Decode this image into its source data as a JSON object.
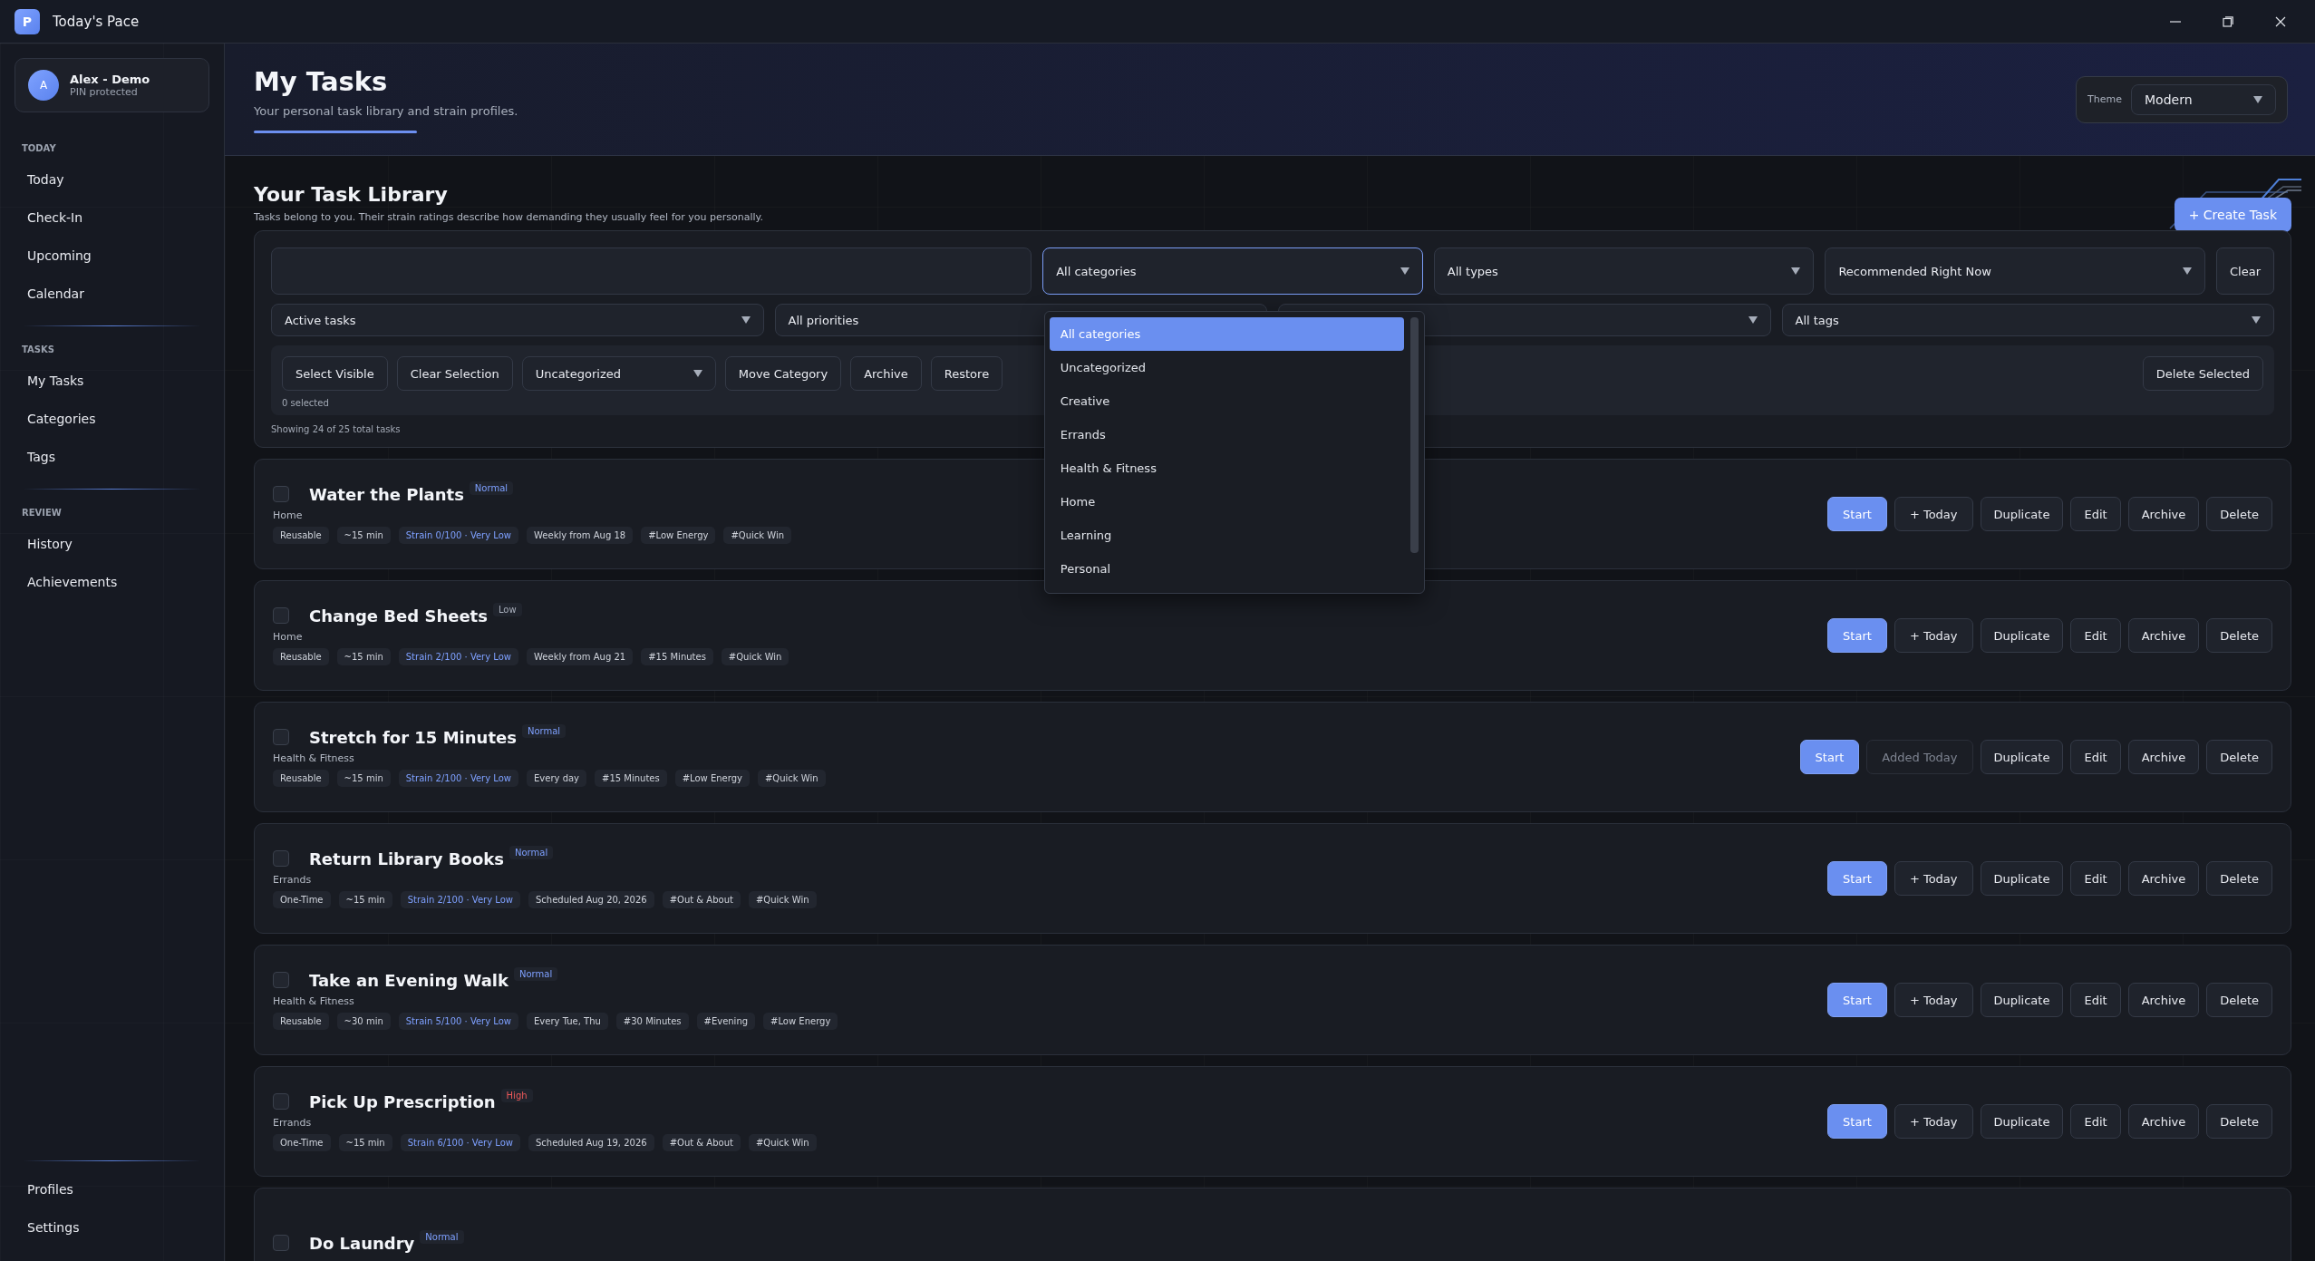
{
  "window": {
    "title": "Today's Pace",
    "logo_letter": "P"
  },
  "profile": {
    "avatar_letter": "A",
    "name": "Alex - Demo",
    "status": "PIN protected"
  },
  "sidebar": {
    "sections": [
      {
        "heading": "TODAY",
        "items": [
          {
            "label": "Today"
          },
          {
            "label": "Check-In"
          },
          {
            "label": "Upcoming"
          },
          {
            "label": "Calendar"
          }
        ]
      },
      {
        "heading": "TASKS",
        "items": [
          {
            "label": "My Tasks"
          },
          {
            "label": "Categories"
          },
          {
            "label": "Tags"
          }
        ]
      },
      {
        "heading": "REVIEW",
        "items": [
          {
            "label": "History"
          },
          {
            "label": "Achievements"
          }
        ]
      }
    ],
    "footer_items": [
      {
        "label": "Profiles"
      },
      {
        "label": "Settings"
      }
    ]
  },
  "header": {
    "title": "My Tasks",
    "subtitle": "Your personal task library and strain profiles.",
    "theme_label": "Theme",
    "theme_value": "Modern"
  },
  "library": {
    "title": "Your Task Library",
    "description": "Tasks belong to you. Their strain ratings describe how demanding they usually feel for you personally.",
    "create_button": "+ Create Task"
  },
  "filters": {
    "row_1": [
      {
        "kind": "search"
      },
      {
        "kind": "select",
        "value": "All categories",
        "focused": true
      },
      {
        "kind": "select",
        "value": "All types",
        "focused": false
      },
      {
        "kind": "select",
        "value": "Recommended Right Now",
        "focused": false
      },
      {
        "kind": "button",
        "value": "Clear"
      }
    ],
    "row_2": [
      {
        "kind": "select",
        "value": "Active tasks"
      },
      {
        "kind": "select",
        "value": "All priorities"
      },
      {
        "kind": "select"
      },
      {
        "kind": "select",
        "value": "All tags"
      }
    ],
    "bulk_actions": [
      {
        "kind": "button",
        "value": "Select Visible"
      },
      {
        "kind": "button",
        "value": "Clear Selection"
      },
      {
        "kind": "select",
        "value": "Uncategorized"
      },
      {
        "kind": "button",
        "value": "Move Category"
      },
      {
        "kind": "button",
        "value": "Archive"
      },
      {
        "kind": "button",
        "value": "Restore"
      }
    ],
    "delete_selected": "Delete Selected",
    "selected_count": "0 selected",
    "showing": "Showing 24 of 25 total tasks"
  },
  "category_dropdown": [
    {
      "label": "All categories",
      "selected": true
    },
    {
      "label": "Uncategorized",
      "selected": false
    },
    {
      "label": "Creative",
      "selected": false
    },
    {
      "label": "Errands",
      "selected": false
    },
    {
      "label": "Health & Fitness",
      "selected": false
    },
    {
      "label": "Home",
      "selected": false
    },
    {
      "label": "Learning",
      "selected": false
    },
    {
      "label": "Personal",
      "selected": false
    }
  ],
  "tasks": [
    {
      "title": "Water the Plants",
      "checked": false,
      "priority": {
        "label": "Normal",
        "kind": "normal"
      },
      "category": "Home",
      "tags": [
        {
          "text": "Reusable",
          "kind": "plain"
        },
        {
          "text": "~15 min",
          "kind": "plain"
        },
        {
          "text": "Strain 0/100 · Very Low",
          "kind": "strain"
        },
        {
          "text": "Weekly from Aug 18",
          "kind": "plain"
        },
        {
          "text": "#Low Energy",
          "kind": "plain"
        },
        {
          "text": "#Quick Win",
          "kind": "plain"
        }
      ],
      "actions": [
        {
          "kind": "start",
          "label": "Start"
        },
        {
          "kind": "today",
          "label": "+ Today",
          "disabled": false
        },
        {
          "kind": "plain",
          "label": "Duplicate"
        },
        {
          "kind": "plain",
          "label": "Edit"
        },
        {
          "kind": "plain",
          "label": "Archive"
        },
        {
          "kind": "plain",
          "label": "Delete"
        }
      ]
    },
    {
      "title": "Change Bed Sheets",
      "checked": false,
      "priority": {
        "label": "Low",
        "kind": "low"
      },
      "category": "Home",
      "tags": [
        {
          "text": "Reusable",
          "kind": "plain"
        },
        {
          "text": "~15 min",
          "kind": "plain"
        },
        {
          "text": "Strain 2/100 · Very Low",
          "kind": "strain"
        },
        {
          "text": "Weekly from Aug 21",
          "kind": "plain"
        },
        {
          "text": "#15 Minutes",
          "kind": "plain"
        },
        {
          "text": "#Quick Win",
          "kind": "plain"
        }
      ],
      "actions": [
        {
          "kind": "start",
          "label": "Start"
        },
        {
          "kind": "today",
          "label": "+ Today",
          "disabled": false
        },
        {
          "kind": "plain",
          "label": "Duplicate"
        },
        {
          "kind": "plain",
          "label": "Edit"
        },
        {
          "kind": "plain",
          "label": "Archive"
        },
        {
          "kind": "plain",
          "label": "Delete"
        }
      ]
    },
    {
      "title": "Stretch for 15 Minutes",
      "checked": false,
      "priority": {
        "label": "Normal",
        "kind": "normal"
      },
      "category": "Health & Fitness",
      "tags": [
        {
          "text": "Reusable",
          "kind": "plain"
        },
        {
          "text": "~15 min",
          "kind": "plain"
        },
        {
          "text": "Strain 2/100 · Very Low",
          "kind": "strain"
        },
        {
          "text": "Every day",
          "kind": "plain"
        },
        {
          "text": "#15 Minutes",
          "kind": "plain"
        },
        {
          "text": "#Low Energy",
          "kind": "plain"
        },
        {
          "text": "#Quick Win",
          "kind": "plain"
        }
      ],
      "actions": [
        {
          "kind": "start",
          "label": "Start"
        },
        {
          "kind": "today",
          "label": "Added Today",
          "disabled": true
        },
        {
          "kind": "plain",
          "label": "Duplicate"
        },
        {
          "kind": "plain",
          "label": "Edit"
        },
        {
          "kind": "plain",
          "label": "Archive"
        },
        {
          "kind": "plain",
          "label": "Delete"
        }
      ]
    },
    {
      "title": "Return Library Books",
      "checked": false,
      "priority": {
        "label": "Normal",
        "kind": "normal"
      },
      "category": "Errands",
      "tags": [
        {
          "text": "One-Time",
          "kind": "plain"
        },
        {
          "text": "~15 min",
          "kind": "plain"
        },
        {
          "text": "Strain 2/100 · Very Low",
          "kind": "strain"
        },
        {
          "text": "Scheduled Aug 20, 2026",
          "kind": "plain"
        },
        {
          "text": "#Out & About",
          "kind": "plain"
        },
        {
          "text": "#Quick Win",
          "kind": "plain"
        }
      ],
      "actions": [
        {
          "kind": "start",
          "label": "Start"
        },
        {
          "kind": "today",
          "label": "+ Today",
          "disabled": false
        },
        {
          "kind": "plain",
          "label": "Duplicate"
        },
        {
          "kind": "plain",
          "label": "Edit"
        },
        {
          "kind": "plain",
          "label": "Archive"
        },
        {
          "kind": "plain",
          "label": "Delete"
        }
      ]
    },
    {
      "title": "Take an Evening Walk",
      "checked": false,
      "priority": {
        "label": "Normal",
        "kind": "normal"
      },
      "category": "Health & Fitness",
      "tags": [
        {
          "text": "Reusable",
          "kind": "plain"
        },
        {
          "text": "~30 min",
          "kind": "plain"
        },
        {
          "text": "Strain 5/100 · Very Low",
          "kind": "strain"
        },
        {
          "text": "Every Tue, Thu",
          "kind": "plain"
        },
        {
          "text": "#30 Minutes",
          "kind": "plain"
        },
        {
          "text": "#Evening",
          "kind": "plain"
        },
        {
          "text": "#Low Energy",
          "kind": "plain"
        }
      ],
      "actions": [
        {
          "kind": "start",
          "label": "Start"
        },
        {
          "kind": "today",
          "label": "+ Today",
          "disabled": false
        },
        {
          "kind": "plain",
          "label": "Duplicate"
        },
        {
          "kind": "plain",
          "label": "Edit"
        },
        {
          "kind": "plain",
          "label": "Archive"
        },
        {
          "kind": "plain",
          "label": "Delete"
        }
      ]
    },
    {
      "title": "Pick Up Prescription",
      "checked": false,
      "priority": {
        "label": "High",
        "kind": "high"
      },
      "category": "Errands",
      "tags": [
        {
          "text": "One-Time",
          "kind": "plain"
        },
        {
          "text": "~15 min",
          "kind": "plain"
        },
        {
          "text": "Strain 6/100 · Very Low",
          "kind": "strain"
        },
        {
          "text": "Scheduled Aug 19, 2026",
          "kind": "plain"
        },
        {
          "text": "#Out & About",
          "kind": "plain"
        },
        {
          "text": "#Quick Win",
          "kind": "plain"
        }
      ],
      "actions": [
        {
          "kind": "start",
          "label": "Start"
        },
        {
          "kind": "today",
          "label": "+ Today",
          "disabled": false
        },
        {
          "kind": "plain",
          "label": "Duplicate"
        },
        {
          "kind": "plain",
          "label": "Edit"
        },
        {
          "kind": "plain",
          "label": "Archive"
        },
        {
          "kind": "plain",
          "label": "Delete"
        }
      ]
    },
    {
      "title": "Do Laundry",
      "checked": false,
      "priority": {
        "label": "Normal",
        "kind": "normal"
      }
    }
  ]
}
